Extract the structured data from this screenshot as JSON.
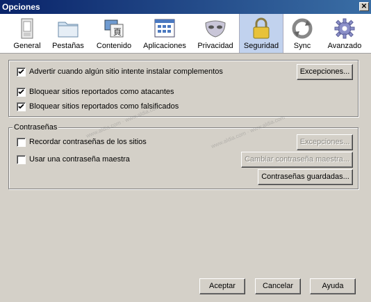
{
  "window": {
    "title": "Opciones",
    "close_label": "✕"
  },
  "tabs": [
    {
      "label": "General",
      "icon": "general-icon"
    },
    {
      "label": "Pestañas",
      "icon": "tabs-folder-icon"
    },
    {
      "label": "Contenido",
      "icon": "content-icon"
    },
    {
      "label": "Aplicaciones",
      "icon": "applications-icon"
    },
    {
      "label": "Privacidad",
      "icon": "privacy-mask-icon"
    },
    {
      "label": "Seguridad",
      "icon": "lock-icon",
      "selected": true
    },
    {
      "label": "Sync",
      "icon": "sync-icon"
    },
    {
      "label": "Avanzado",
      "icon": "gear-icon"
    }
  ],
  "security": {
    "warn_addons": {
      "label": "Advertir cuando algún sitio intente instalar complementos",
      "checked": true
    },
    "exceptions_label": "Excepciones...",
    "block_attack": {
      "label": "Bloquear sitios reportados como atacantes",
      "checked": true
    },
    "block_forgery": {
      "label": "Bloquear sitios reportados como falsificados",
      "checked": true
    }
  },
  "passwords": {
    "legend": "Contraseñas",
    "remember": {
      "label": "Recordar contraseñas de los sitios",
      "checked": false
    },
    "exceptions_label": "Excepciones...",
    "master": {
      "label": "Usar una contraseña maestra",
      "checked": false
    },
    "change_master_label": "Cambiar contraseña maestra...",
    "saved_label": "Contraseñas guardadas..."
  },
  "footer": {
    "accept": "Aceptar",
    "cancel": "Cancelar",
    "help": "Ayuda"
  },
  "watermark": "www.aldia.com  ·  www.aldia.com"
}
